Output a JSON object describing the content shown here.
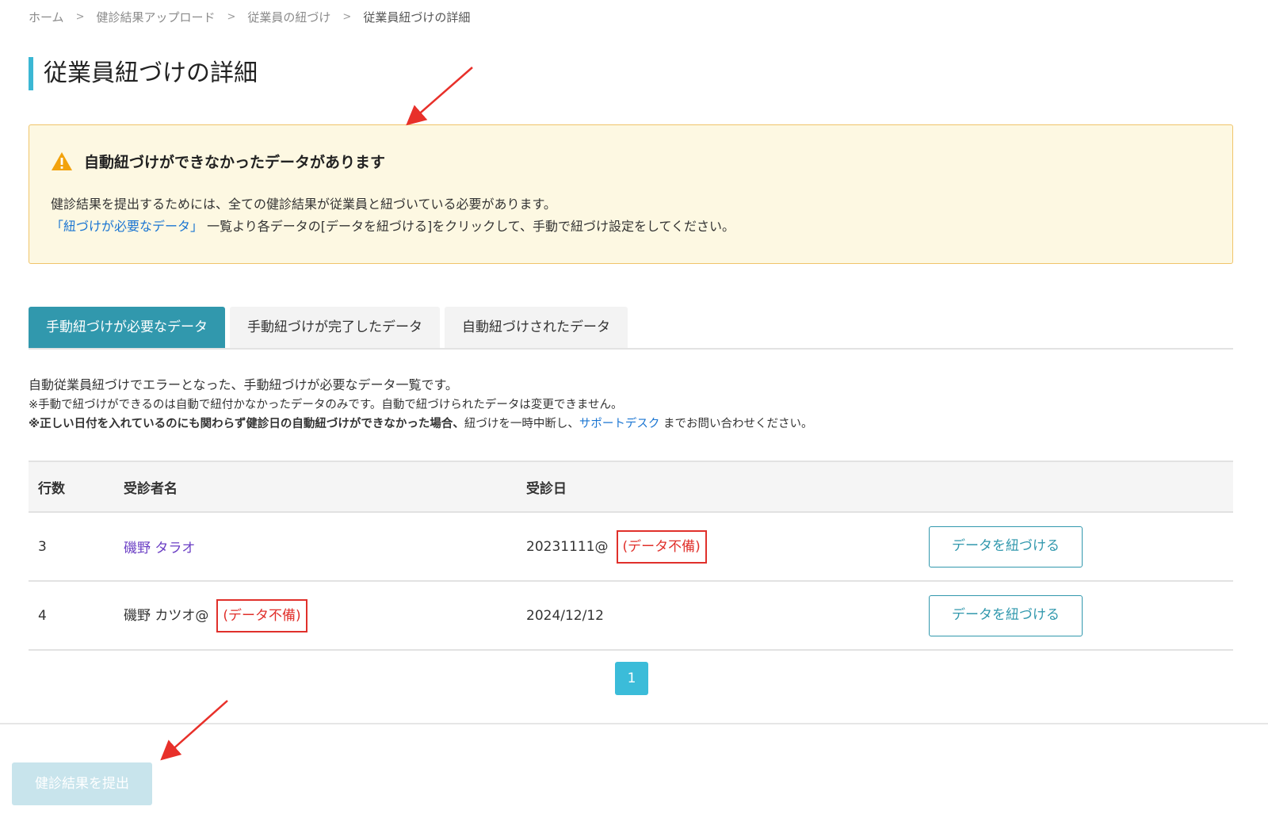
{
  "breadcrumb": {
    "items": [
      "ホーム",
      "健診結果アップロード",
      "従業員の紐づけ"
    ],
    "current": "従業員紐づけの詳細",
    "separator": ">"
  },
  "page_title": "従業員紐づけの詳細",
  "alert": {
    "icon": "warning-icon",
    "heading": "自動紐づけができなかったデータがあります",
    "line1": "健診結果を提出するためには、全ての健診結果が従業員と紐づいている必要があります。",
    "link_text": "「紐づけが必要なデータ」",
    "line2_rest": " 一覧より各データの[データを紐づける]をクリックして、手動で紐づけ設定をしてください。"
  },
  "tabs": [
    {
      "label": "手動紐づけが必要なデータ",
      "active": true
    },
    {
      "label": "手動紐づけが完了したデータ",
      "active": false
    },
    {
      "label": "自動紐づけされたデータ",
      "active": false
    }
  ],
  "description": {
    "line1": "自動従業員紐づけでエラーとなった、手動紐づけが必要なデータ一覧です。",
    "line2": "※手動で紐づけができるのは自動で紐付かなかったデータのみです。自動で紐づけられたデータは変更できません。",
    "line3_bold": "※正しい日付を入れているのにも関わらず健診日の自動紐づけができなかった場合、",
    "line3_mid": "紐づけを一時中断し、",
    "line3_link": "サポートデスク",
    "line3_end": " までお問い合わせください。"
  },
  "table": {
    "headers": {
      "row": "行数",
      "name": "受診者名",
      "date": "受診日"
    },
    "rows": [
      {
        "row": "3",
        "name": "磯野 タラオ",
        "name_flag": "",
        "date": "20231111@",
        "date_flag": "(データ不備)",
        "button": "データを紐づける"
      },
      {
        "row": "4",
        "name": "磯野 カツオ@",
        "name_flag": "(データ不備)",
        "date": "2024/12/12",
        "date_flag": "",
        "button": "データを紐づける"
      }
    ]
  },
  "pagination": {
    "current_page": "1"
  },
  "submit_button": "健診結果を提出",
  "colors": {
    "accent": "#3198ad",
    "title_bar": "#3bb7d4",
    "alert_bg": "#fdf8e2",
    "alert_border": "#f0c46a",
    "link": "#1a75d2",
    "error": "#e0302b",
    "annotation_arrow": "#e8302a"
  }
}
